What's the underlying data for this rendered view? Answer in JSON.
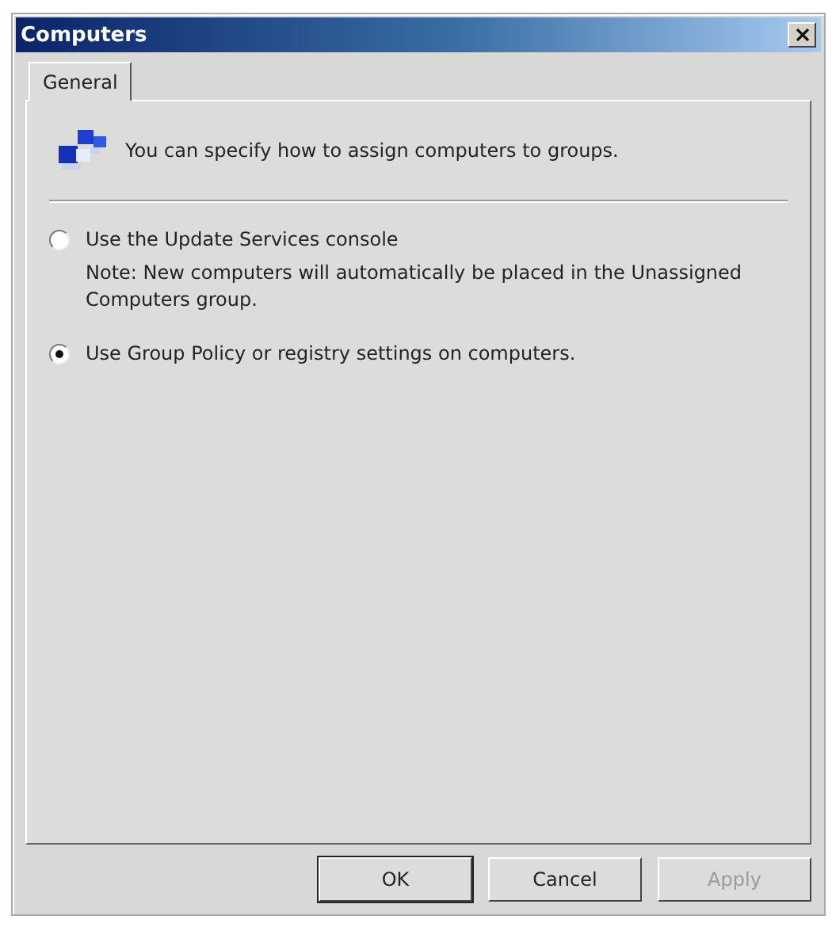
{
  "window": {
    "title": "Computers"
  },
  "tabs": [
    {
      "label": "General",
      "selected": true
    }
  ],
  "intro": "You can specify how to assign computers to groups.",
  "options": [
    {
      "label": "Use the Update Services console",
      "note": "Note: New computers will automatically be placed in the Unassigned Computers group.",
      "selected": false
    },
    {
      "label": "Use Group Policy or registry settings on computers.",
      "selected": true
    }
  ],
  "buttons": [
    {
      "label": "OK",
      "disabled": false,
      "default": true
    },
    {
      "label": "Cancel",
      "disabled": false,
      "default": false
    },
    {
      "label": "Apply",
      "disabled": true,
      "default": false
    }
  ]
}
